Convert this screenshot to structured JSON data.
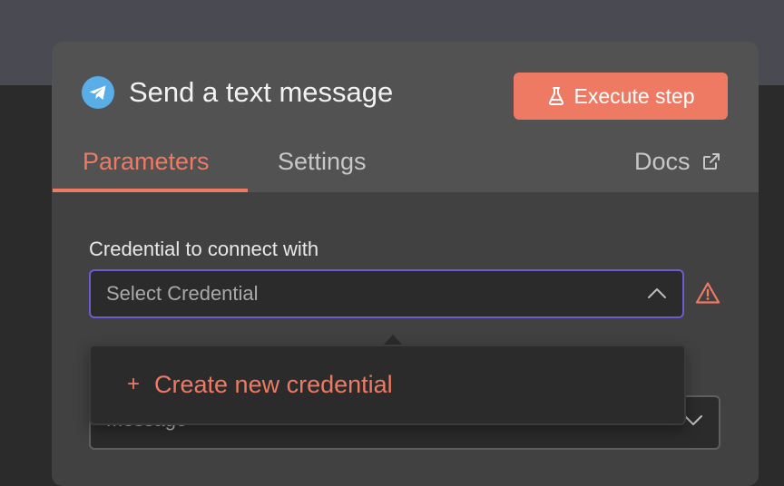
{
  "node": {
    "title": "Send a text message",
    "icon": "telegram-icon"
  },
  "header": {
    "execute_label": "Execute step",
    "execute_icon": "flask-icon"
  },
  "tabs": [
    {
      "label": "Parameters",
      "active": true
    },
    {
      "label": "Settings",
      "active": false
    },
    {
      "label": "Docs",
      "active": false,
      "icon": "external-link-icon"
    }
  ],
  "credential": {
    "label": "Credential to connect with",
    "placeholder": "Select Credential",
    "warning_icon": "warning-icon"
  },
  "dropdown": {
    "create_label": "Create new credential",
    "create_icon": "+"
  },
  "message_field": {
    "value": "Message"
  },
  "colors": {
    "accent": "#ee7a63",
    "focus_border": "#6d5ccf",
    "telegram": "#5aaee7"
  }
}
